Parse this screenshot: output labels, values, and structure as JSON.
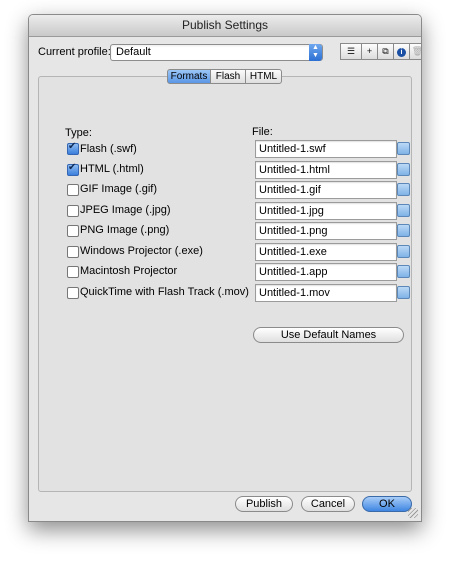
{
  "window": {
    "title": "Publish Settings"
  },
  "profile": {
    "label": "Current profile:",
    "value": "Default"
  },
  "toolbar": {
    "buttons": [
      {
        "name": "profile-menu-icon"
      },
      {
        "name": "add-profile-icon",
        "glyph": "+"
      },
      {
        "name": "duplicate-profile-icon"
      },
      {
        "name": "info-icon",
        "glyph": "i"
      },
      {
        "name": "trash-icon"
      }
    ]
  },
  "tabs": [
    {
      "label": "Formats",
      "active": true
    },
    {
      "label": "Flash",
      "active": false
    },
    {
      "label": "HTML",
      "active": false
    }
  ],
  "formats": {
    "type_header": "Type:",
    "file_header": "File:",
    "rows": [
      {
        "label": "Flash  (.swf)",
        "checked": true,
        "file": "Untitled-1.swf"
      },
      {
        "label": "HTML  (.html)",
        "checked": true,
        "file": "Untitled-1.html"
      },
      {
        "label": "GIF Image  (.gif)",
        "checked": false,
        "file": "Untitled-1.gif"
      },
      {
        "label": "JPEG Image  (.jpg)",
        "checked": false,
        "file": "Untitled-1.jpg"
      },
      {
        "label": "PNG Image  (.png)",
        "checked": false,
        "file": "Untitled-1.png"
      },
      {
        "label": "Windows Projector  (.exe)",
        "checked": false,
        "file": "Untitled-1.exe"
      },
      {
        "label": "Macintosh Projector",
        "checked": false,
        "file": "Untitled-1.app"
      },
      {
        "label": "QuickTime with Flash Track  (.mov)",
        "checked": false,
        "file": "Untitled-1.mov"
      }
    ],
    "default_names_label": "Use Default Names"
  },
  "footer": {
    "publish_label": "Publish",
    "cancel_label": "Cancel",
    "ok_label": "OK"
  },
  "colors": {
    "accent": "#3f86e2",
    "window_bg": "#e6e6e6"
  }
}
